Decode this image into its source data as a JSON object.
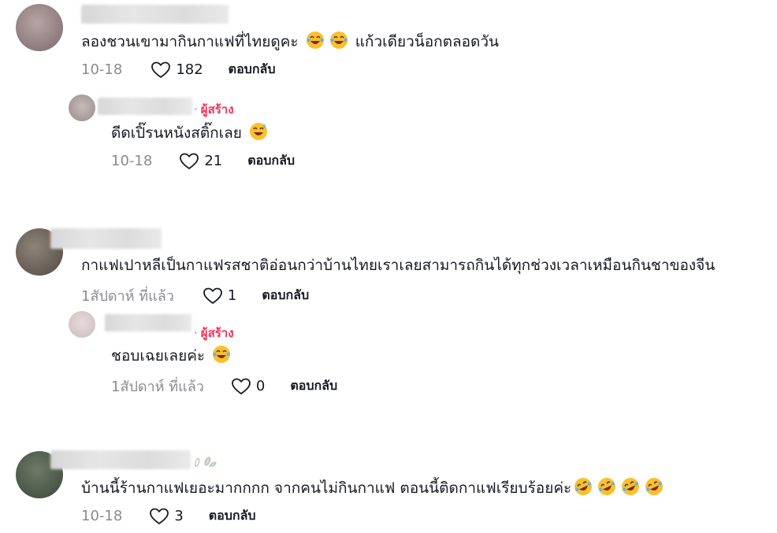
{
  "comments": [
    {
      "text": "ลองชวนเขามากินกาแฟที่ไทยดูคะ",
      "text_tail": "แก้วเดียวน็อกตลอดวัน",
      "emojis": [
        "laughing-face",
        "laughing-face"
      ],
      "date": "10-18",
      "likes": "182",
      "reply_label": "ตอบกลับ",
      "reply": {
        "creator_label": "ผู้สร้าง",
        "separator": "·",
        "text": "ดีดเปิ๊รนหนังสติ๊กเลย",
        "emojis": [
          "sweat-smile-face"
        ],
        "date": "10-18",
        "likes": "21",
        "reply_label": "ตอบกลับ"
      }
    },
    {
      "text": "กาแฟเปาหลีเป็นกาแฟรสชาติอ่อนกว่าบ้านไทยเราเลยสามารถกินได้ทุกช่วงเวลาเหมือนกินชาของจีน",
      "date": "1สัปดาห์ ที่แล้ว",
      "likes": "1",
      "reply_label": "ตอบกลับ",
      "reply": {
        "creator_label": "ผู้สร้าง",
        "separator": "·",
        "text": "ชอบเฉยเลยค่ะ",
        "emojis": [
          "laughing-face"
        ],
        "date": "1สัปดาห์ ที่แล้ว",
        "likes": "0",
        "reply_label": "ตอบกลับ"
      }
    },
    {
      "text": "บ้านนี้ร้านกาแฟเยอะมากกกก จากคนไม่กินกาแฟ ตอนนี้ติดกาแฟเรียบร้อยค่ะ",
      "emojis": [
        "rofl-face",
        "rofl-face",
        "rofl-face",
        "rofl-face"
      ],
      "date": "10-18",
      "likes": "3",
      "reply_label": "ตอบกลับ"
    }
  ],
  "colors": {
    "creator": "#fe2c55",
    "meta": "#8a8b91",
    "text": "#161823"
  }
}
